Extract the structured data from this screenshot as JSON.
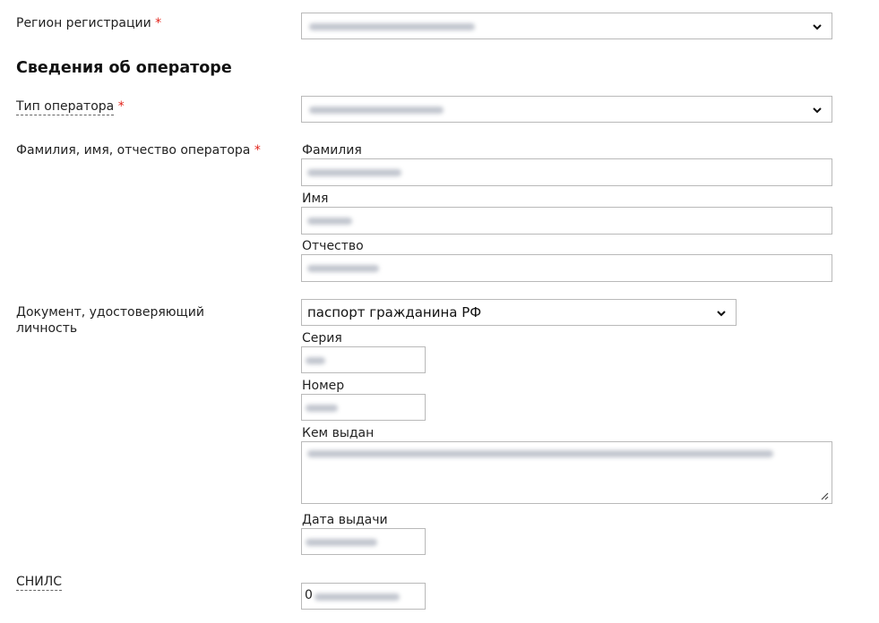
{
  "registration": {
    "label": "Регион регистрации",
    "required": "*"
  },
  "section": {
    "title": "Сведения об операторе"
  },
  "operator_type": {
    "label": "Тип оператора",
    "required": "*"
  },
  "full_name": {
    "label": "Фамилия, имя, отчество оператора",
    "required": "*",
    "surname_label": "Фамилия",
    "name_label": "Имя",
    "patronymic_label": "Отчество"
  },
  "identity_doc": {
    "label": "Документ, удостоверяющий личность",
    "selected": "паспорт гражданина РФ",
    "series_label": "Серия",
    "number_label": "Номер",
    "issued_by_label": "Кем выдан",
    "issue_date_label": "Дата выдачи"
  },
  "snils": {
    "label": "СНИЛС",
    "value_prefix": "0"
  },
  "icons": {
    "select_arrow": "chevron-down-icon",
    "resize": "resize-grip-icon"
  },
  "colors": {
    "required": "#e2231a",
    "border": "#b9b9b9"
  }
}
